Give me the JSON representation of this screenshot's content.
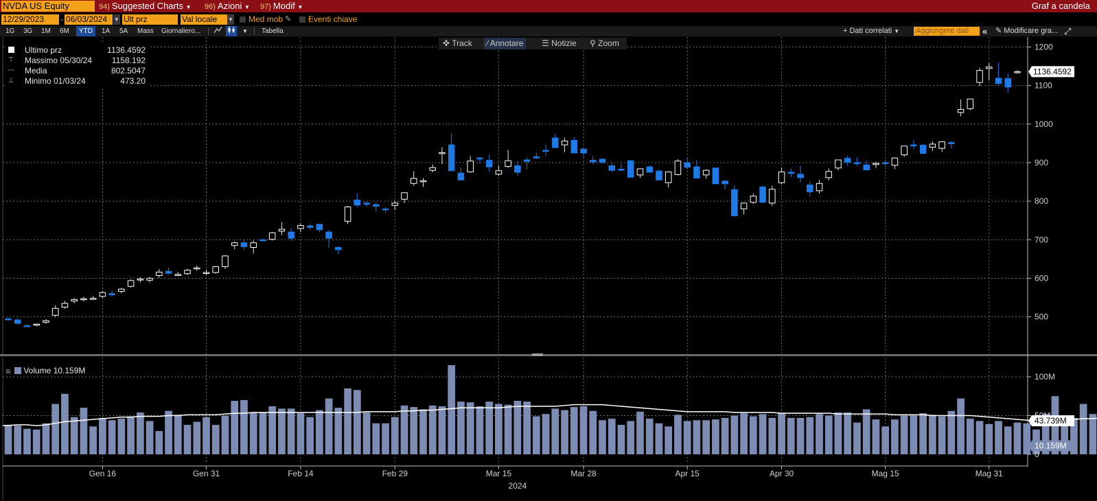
{
  "topbar": {
    "ticker": "NVDA US Equity",
    "suggested_num": "94)",
    "suggested_label": "Suggested Charts",
    "azioni_num": "96)",
    "azioni_label": "Azioni",
    "modif_num": "97)",
    "modif_label": "Modif",
    "right_title": "Graf a candela"
  },
  "controls": {
    "start_date": "12/29/2023",
    "end_date": "06/03/2024",
    "price_field": "Ult prz",
    "currency_field": "Val locale",
    "med_mob": "Med mob",
    "eventi": "Eventi chiave"
  },
  "periods": [
    "1G",
    "3G",
    "1M",
    "6M",
    "YTD",
    "1A",
    "5A",
    "Mass"
  ],
  "selected_period": "YTD",
  "frequency": "Giornaliero...",
  "tabella": "Tabella",
  "dati_correlati": "+ Dati correlati",
  "aggiungere_placeholder": "Aggiungere dati",
  "modificare": "Modificare gra...",
  "toolbox": [
    "Track",
    "Annotare",
    "Notizie",
    "Zoom"
  ],
  "legend": {
    "last_label": "Ultimo prz",
    "last_value": "1136.4592",
    "high_label": "Massimo 05/30/24",
    "high_value": "1158.192",
    "avg_label": "Media",
    "avg_value": "802.5047",
    "low_label": "Minimo 01/03/24",
    "low_value": "473.20"
  },
  "volume_legend": "Volume 10.159M",
  "colors": {
    "up": "#ffffff",
    "down": "#1f7ae6",
    "volume": "#7d8cb3",
    "ma": "#ffffff",
    "accent": "#f4a11a",
    "topbar": "#8b0f14"
  },
  "chart_data": {
    "type": "candlestick",
    "price_axis": {
      "ticks": [
        500,
        600,
        700,
        800,
        900,
        1000,
        1100,
        1200
      ],
      "labels": [
        "500",
        "600",
        "700",
        "800",
        "900",
        "1000",
        "1100",
        "1200"
      ],
      "range": [
        405,
        1215
      ]
    },
    "last_price_label": "1136.4592",
    "volume_axis": {
      "ticks": [
        0,
        50,
        100
      ],
      "labels": [
        "0",
        "50M",
        "100M"
      ]
    },
    "volume_last_label": "10.159M",
    "volume_ma_label": "43.739M",
    "x_labels": [
      "Gen 16",
      "Gen 31",
      "Feb 14",
      "Feb 29",
      "Mar 15",
      "Mar 28",
      "Apr 15",
      "Apr 30",
      "Mag 15",
      "Mag 31"
    ],
    "x_label_index": [
      10,
      21,
      31,
      41,
      52,
      61,
      72,
      82,
      93,
      104
    ],
    "year_label": "2024",
    "candles": [
      [
        495,
        497,
        490,
        494
      ],
      [
        492,
        496,
        480,
        483
      ],
      [
        477,
        481,
        473,
        476
      ],
      [
        479,
        482,
        475,
        481
      ],
      [
        486,
        494,
        482,
        490
      ],
      [
        504,
        530,
        500,
        522
      ],
      [
        525,
        541,
        521,
        535
      ],
      [
        541,
        548,
        535,
        545
      ],
      [
        545,
        552,
        540,
        547
      ],
      [
        546,
        554,
        544,
        548
      ],
      [
        553,
        567,
        549,
        563
      ],
      [
        560,
        568,
        552,
        557
      ],
      [
        566,
        575,
        561,
        572
      ],
      [
        579,
        597,
        576,
        594
      ],
      [
        596,
        603,
        590,
        598
      ],
      [
        595,
        604,
        589,
        600
      ],
      [
        607,
        624,
        601,
        616
      ],
      [
        618,
        628,
        610,
        613
      ],
      [
        610,
        616,
        606,
        610
      ],
      [
        612,
        625,
        608,
        621
      ],
      [
        625,
        633,
        620,
        627
      ],
      [
        614,
        622,
        608,
        615
      ],
      [
        615,
        632,
        612,
        630
      ],
      [
        630,
        660,
        624,
        658
      ],
      [
        685,
        696,
        675,
        692
      ],
      [
        692,
        699,
        674,
        682
      ],
      [
        680,
        698,
        664,
        692
      ],
      [
        700,
        702,
        695,
        699
      ],
      [
        701,
        720,
        698,
        718
      ],
      [
        722,
        745,
        712,
        727
      ],
      [
        720,
        730,
        697,
        704
      ],
      [
        729,
        742,
        720,
        737
      ],
      [
        736,
        741,
        726,
        732
      ],
      [
        740,
        741,
        720,
        726
      ],
      [
        720,
        725,
        679,
        704
      ],
      [
        680,
        683,
        663,
        674
      ],
      [
        748,
        788,
        741,
        785
      ],
      [
        803,
        820,
        785,
        790
      ],
      [
        795,
        799,
        786,
        792
      ],
      [
        791,
        797,
        773,
        787
      ],
      [
        780,
        785,
        770,
        778
      ],
      [
        789,
        802,
        777,
        795
      ],
      [
        805,
        822,
        795,
        822
      ],
      [
        846,
        878,
        840,
        859
      ],
      [
        852,
        860,
        837,
        853
      ],
      [
        880,
        895,
        875,
        887
      ],
      [
        925,
        940,
        896,
        926
      ],
      [
        946,
        976,
        930,
        879
      ],
      [
        873,
        888,
        860,
        855
      ],
      [
        876,
        917,
        874,
        904
      ],
      [
        912,
        915,
        899,
        910
      ],
      [
        906,
        920,
        877,
        889
      ],
      [
        870,
        892,
        866,
        879
      ],
      [
        890,
        933,
        887,
        905
      ],
      [
        892,
        904,
        866,
        875
      ],
      [
        907,
        915,
        883,
        903
      ],
      [
        915,
        925,
        910,
        912
      ],
      [
        932,
        947,
        916,
        930
      ],
      [
        964,
        974,
        943,
        939
      ],
      [
        946,
        965,
        927,
        956
      ],
      [
        958,
        966,
        930,
        925
      ],
      [
        935,
        940,
        915,
        925
      ],
      [
        906,
        917,
        895,
        902
      ],
      [
        909,
        911,
        899,
        900
      ],
      [
        892,
        899,
        876,
        880
      ],
      [
        883,
        896,
        878,
        881
      ],
      [
        905,
        906,
        869,
        862
      ],
      [
        868,
        885,
        860,
        884
      ],
      [
        889,
        893,
        881,
        875
      ],
      [
        878,
        883,
        854,
        855
      ],
      [
        848,
        875,
        835,
        876
      ],
      [
        869,
        909,
        867,
        904
      ],
      [
        900,
        911,
        882,
        888
      ],
      [
        889,
        906,
        880,
        860
      ],
      [
        868,
        883,
        858,
        880
      ],
      [
        886,
        887,
        851,
        845
      ],
      [
        852,
        854,
        831,
        845
      ],
      [
        830,
        841,
        762,
        762
      ],
      [
        780,
        797,
        766,
        795
      ],
      [
        797,
        820,
        793,
        813
      ],
      [
        837,
        841,
        795,
        797
      ],
      [
        795,
        840,
        788,
        831
      ],
      [
        848,
        887,
        844,
        876
      ],
      [
        875,
        884,
        862,
        874
      ],
      [
        870,
        891,
        849,
        861
      ],
      [
        842,
        852,
        812,
        824
      ],
      [
        827,
        855,
        820,
        846
      ],
      [
        861,
        885,
        854,
        877
      ],
      [
        886,
        907,
        880,
        907
      ],
      [
        911,
        918,
        892,
        901
      ],
      [
        900,
        914,
        892,
        898
      ],
      [
        894,
        905,
        880,
        881
      ],
      [
        895,
        902,
        886,
        898
      ],
      [
        900,
        908,
        889,
        898
      ],
      [
        893,
        913,
        883,
        912
      ],
      [
        920,
        941,
        915,
        943
      ],
      [
        946,
        959,
        935,
        944
      ],
      [
        945,
        948,
        922,
        924
      ],
      [
        940,
        955,
        930,
        948
      ],
      [
        937,
        950,
        928,
        954
      ],
      [
        952,
        956,
        936,
        949
      ],
      [
        1030,
        1064,
        1020,
        1038
      ],
      [
        1040,
        1064,
        1036,
        1065
      ],
      [
        1108,
        1146,
        1098,
        1139
      ],
      [
        1144,
        1158,
        1113,
        1148
      ],
      [
        1119,
        1159,
        1102,
        1105
      ],
      [
        1118,
        1131,
        1081,
        1096
      ],
      [
        1136,
        1140,
        1130,
        1136
      ]
    ],
    "volume": [
      38,
      37,
      33,
      32,
      40,
      65,
      78,
      48,
      60,
      36,
      47,
      44,
      46,
      49,
      54,
      43,
      30,
      56,
      51,
      38,
      42,
      48,
      38,
      50,
      69,
      70,
      54,
      54,
      62,
      59,
      59,
      53,
      48,
      57,
      72,
      60,
      85,
      83,
      54,
      40,
      40,
      48,
      63,
      61,
      58,
      63,
      62,
      115,
      68,
      67,
      62,
      68,
      65,
      64,
      69,
      68,
      49,
      52,
      59,
      57,
      61,
      62,
      56,
      44,
      46,
      38,
      43,
      55,
      46,
      40,
      36,
      51,
      43,
      44,
      44,
      45,
      47,
      50,
      53,
      49,
      52,
      47,
      53,
      47,
      47,
      48,
      52,
      50,
      54,
      54,
      41,
      58,
      45,
      36,
      45,
      50,
      50,
      53,
      51,
      49,
      56,
      72,
      46,
      43,
      39,
      43,
      36,
      41,
      40,
      32,
      52,
      75,
      42,
      47,
      65,
      52,
      60,
      49,
      62,
      11
    ],
    "volume_ma": [
      37,
      38,
      38,
      37,
      38,
      40,
      42,
      43,
      44,
      45,
      46,
      47,
      48,
      48,
      49,
      49,
      49,
      50,
      50,
      51,
      51,
      51,
      51,
      52,
      53,
      53,
      54,
      54,
      54,
      54,
      54,
      54,
      54,
      54,
      54,
      54,
      54,
      54,
      55,
      55,
      55,
      55,
      56,
      56,
      57,
      57,
      58,
      59,
      60,
      60,
      60,
      60,
      60,
      61,
      62,
      62,
      62,
      62,
      62,
      63,
      64,
      64,
      64,
      64,
      63,
      62,
      61,
      60,
      59,
      58,
      57,
      56,
      55,
      55,
      55,
      55,
      55,
      54,
      54,
      54,
      54,
      54,
      53,
      53,
      53,
      53,
      53,
      53,
      52,
      52,
      52,
      52,
      52,
      52,
      51,
      51,
      51,
      51,
      50,
      50,
      50,
      50,
      50,
      49,
      48,
      47,
      46,
      45,
      44,
      43,
      43,
      43,
      44,
      45,
      46,
      46,
      47,
      47,
      47,
      45
    ]
  }
}
